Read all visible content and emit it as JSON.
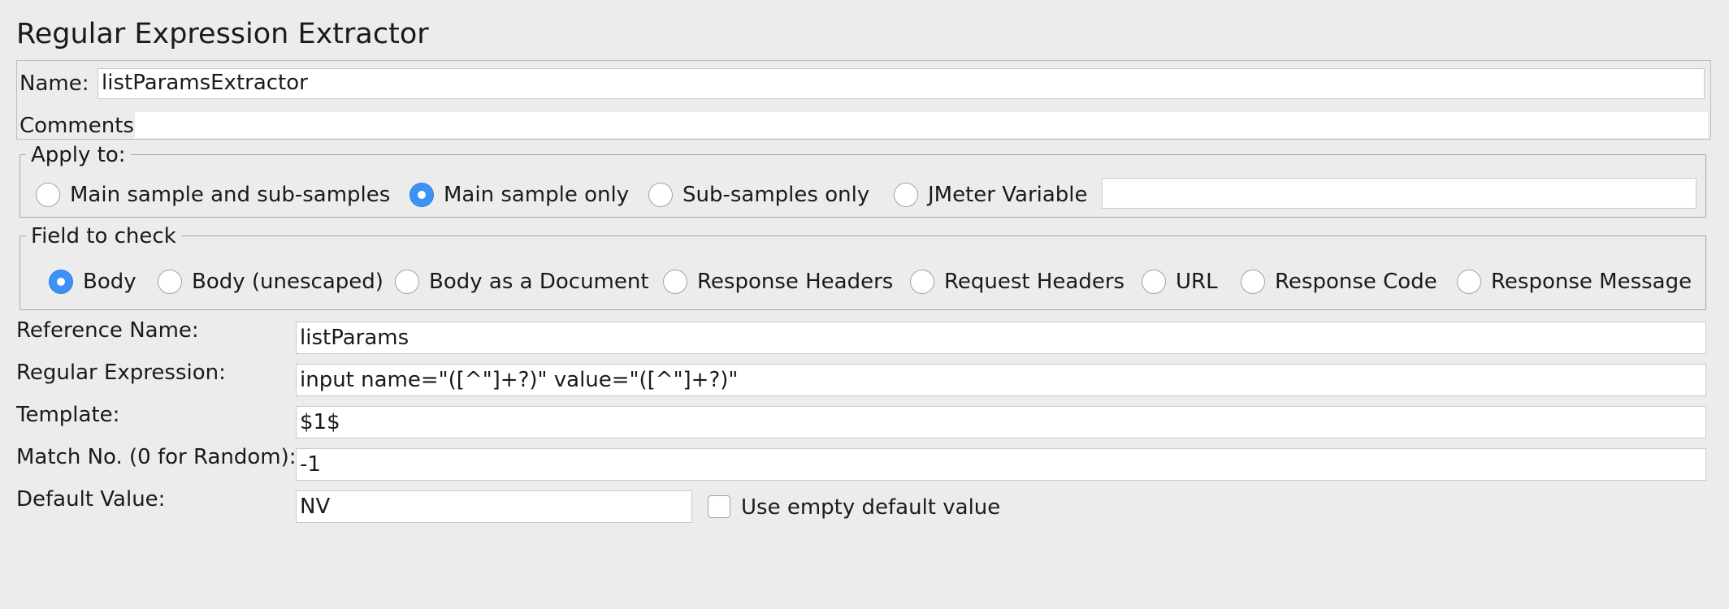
{
  "panel_title": "Regular Expression Extractor",
  "name_label": "Name:",
  "name_value": "listParamsExtractor",
  "comments_label": "Comments:",
  "comments_value": "",
  "apply_to": {
    "legend": "Apply to:",
    "options": [
      {
        "label": "Main sample and sub-samples",
        "selected": false
      },
      {
        "label": "Main sample only",
        "selected": true
      },
      {
        "label": "Sub-samples only",
        "selected": false
      },
      {
        "label": "JMeter Variable",
        "selected": false
      }
    ],
    "variable_value": ""
  },
  "field_to_check": {
    "legend": "Field to check",
    "options": [
      {
        "label": "Body",
        "selected": true
      },
      {
        "label": "Body (unescaped)",
        "selected": false
      },
      {
        "label": "Body as a Document",
        "selected": false
      },
      {
        "label": "Response Headers",
        "selected": false
      },
      {
        "label": "Request Headers",
        "selected": false
      },
      {
        "label": "URL",
        "selected": false
      },
      {
        "label": "Response Code",
        "selected": false
      },
      {
        "label": "Response Message",
        "selected": false
      }
    ]
  },
  "form": {
    "reference_name": {
      "label": "Reference Name:",
      "value": "listParams"
    },
    "regular_expression": {
      "label": "Regular Expression:",
      "value": "input name=\"([^\"]+?)\" value=\"([^\"]+?)\""
    },
    "template": {
      "label": "Template:",
      "value": "$1$"
    },
    "match_no": {
      "label": "Match No. (0 for Random):",
      "value": "-1"
    },
    "default_value": {
      "label": "Default Value:",
      "value": "NV"
    }
  },
  "use_empty_default": {
    "label": "Use empty default value",
    "checked": false
  }
}
